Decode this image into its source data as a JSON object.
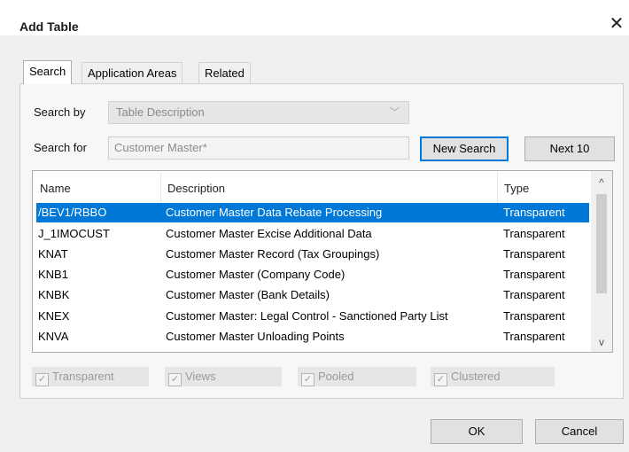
{
  "dialog": {
    "title": "Add Table",
    "close_glyph": "✕"
  },
  "tabs": [
    {
      "label": "Search",
      "active": true
    },
    {
      "label": "Application Areas",
      "active": false
    },
    {
      "label": "Related",
      "active": false
    }
  ],
  "search": {
    "search_by_label": "Search by",
    "search_by_value": "Table Description",
    "search_for_label": "Search for",
    "search_for_value": "Customer Master*",
    "new_search_label": "New Search",
    "next_label": "Next 10"
  },
  "table": {
    "columns": [
      "Name",
      "Description",
      "Type"
    ],
    "rows": [
      {
        "name": "/BEV1/RBBO",
        "description": "Customer Master Data Rebate Processing",
        "type": "Transparent",
        "selected": true
      },
      {
        "name": "J_1IMOCUST",
        "description": "Customer Master Excise Additional Data",
        "type": "Transparent"
      },
      {
        "name": "KNAT",
        "description": "Customer Master Record (Tax Groupings)",
        "type": "Transparent"
      },
      {
        "name": "KNB1",
        "description": "Customer Master (Company Code)",
        "type": "Transparent"
      },
      {
        "name": "KNBK",
        "description": "Customer Master (Bank Details)",
        "type": "Transparent"
      },
      {
        "name": "KNEX",
        "description": "Customer Master: Legal Control - Sanctioned Party List",
        "type": "Transparent"
      },
      {
        "name": "KNVA",
        "description": "Customer Master Unloading Points",
        "type": "Transparent"
      }
    ]
  },
  "filters": [
    {
      "label": "Transparent",
      "checked": true
    },
    {
      "label": "Views",
      "checked": true
    },
    {
      "label": "Pooled",
      "checked": true
    },
    {
      "label": "Clustered",
      "checked": true
    }
  ],
  "footer": {
    "ok_label": "OK",
    "cancel_label": "Cancel"
  },
  "icons": {
    "check": "✓",
    "chevron_down": "﹀",
    "scroll_up": "^",
    "scroll_down": "v"
  },
  "colors": {
    "selection": "#0078d7",
    "dialog_bg": "#f0f0f0"
  }
}
